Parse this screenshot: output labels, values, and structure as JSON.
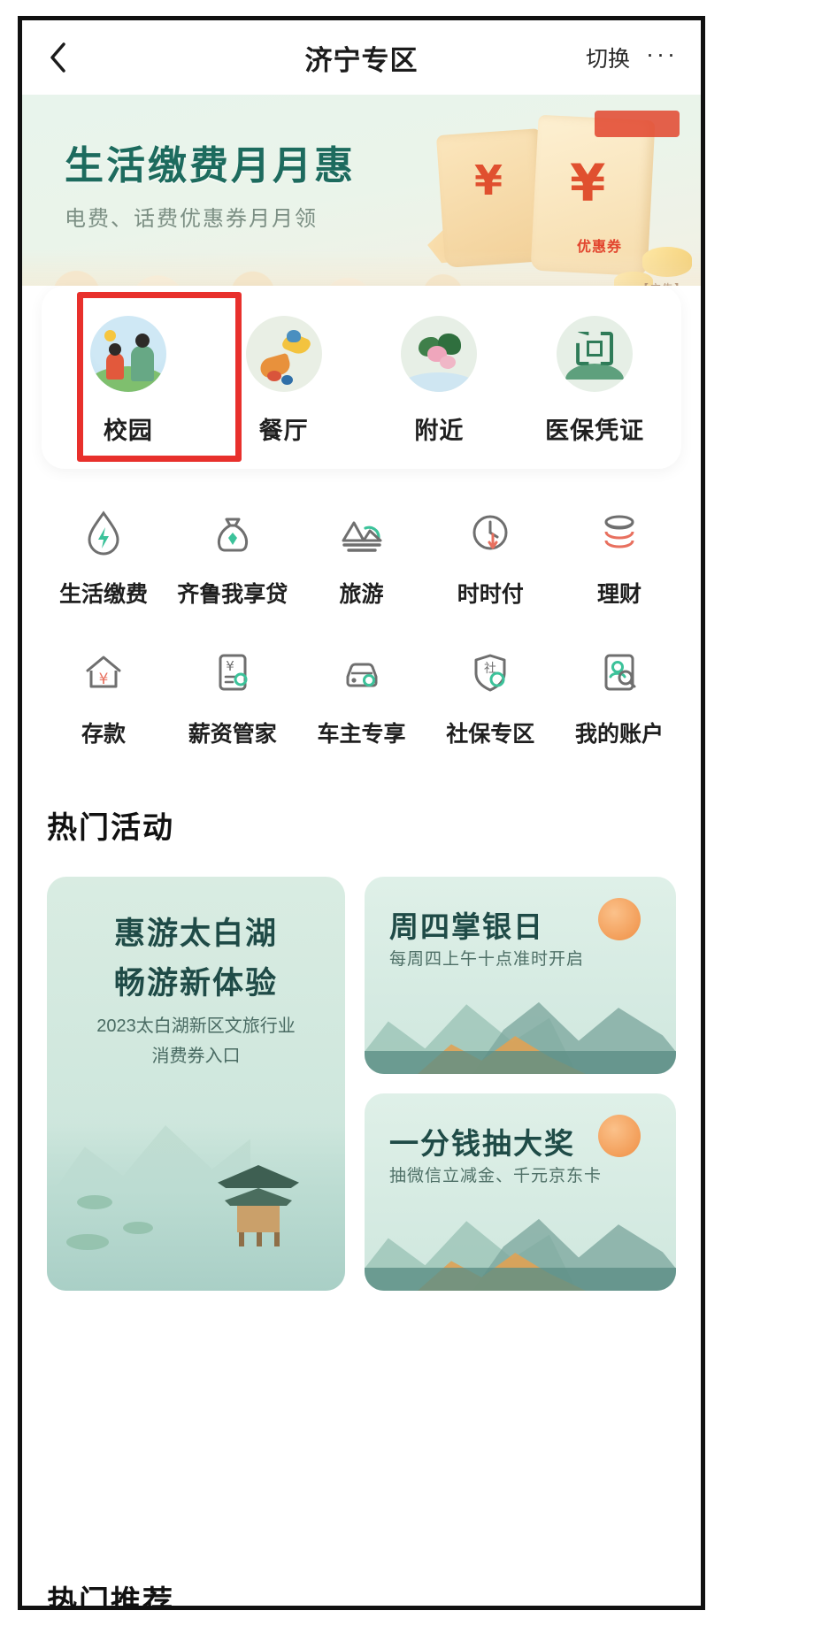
{
  "header": {
    "back_icon": "chevron-left-icon",
    "title": "济宁专区",
    "switch_label": "切换",
    "more_icon": "···"
  },
  "banner": {
    "title": "生活缴费月月惠",
    "subtitle": "电费、话费优惠券月月领",
    "coupon_text": "优惠券",
    "ad_label": "【广告】"
  },
  "quick_actions": {
    "highlighted_index": 0,
    "items": [
      {
        "label": "校园",
        "icon": "campus-icon"
      },
      {
        "label": "餐厅",
        "icon": "restaurant-icon"
      },
      {
        "label": "附近",
        "icon": "nearby-icon"
      },
      {
        "label": "医保凭证",
        "icon": "medical-insurance-credential-icon"
      }
    ]
  },
  "services": {
    "row1": [
      {
        "label": "生活缴费",
        "icon": "water-drop-bolt-icon"
      },
      {
        "label": "齐鲁我享贷",
        "icon": "money-bag-icon"
      },
      {
        "label": "旅游",
        "icon": "mountain-icon"
      },
      {
        "label": "时时付",
        "icon": "clock-icon"
      },
      {
        "label": "理财",
        "icon": "coin-stack-icon"
      }
    ],
    "row2": [
      {
        "label": "存款",
        "icon": "house-yuan-icon"
      },
      {
        "label": "薪资管家",
        "icon": "payslip-icon"
      },
      {
        "label": "车主专享",
        "icon": "car-icon"
      },
      {
        "label": "社保专区",
        "icon": "shield-social-security-icon"
      },
      {
        "label": "我的账户",
        "icon": "account-search-icon"
      }
    ]
  },
  "hot_activities": {
    "section_title": "热门活动",
    "cards": [
      {
        "title_line1": "惠游太白湖",
        "title_line2": "畅游新体验",
        "sub_line1": "2023太白湖新区文旅行业",
        "sub_line2": "消费券入口"
      },
      {
        "title": "周四掌银日",
        "subtitle": "每周四上午十点准时开启"
      },
      {
        "title": "一分钱抽大奖",
        "subtitle": "抽微信立减金、千元京东卡"
      }
    ]
  },
  "bottom_peek": {
    "text": "热门推荐"
  },
  "colors": {
    "highlight_red": "#e8302c",
    "brand_green": "#1d6b5e",
    "accent_teal": "#3cc29a",
    "accent_red": "#e8705f",
    "text_dark": "#1f1f1f"
  }
}
